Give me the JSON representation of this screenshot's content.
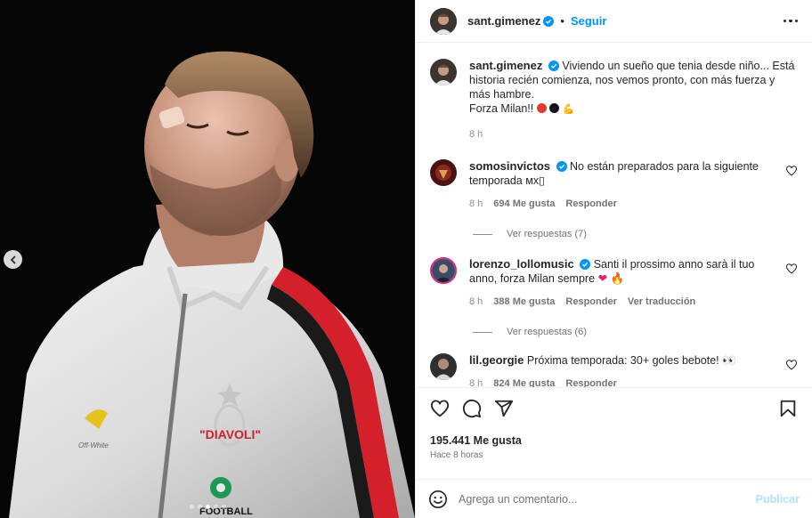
{
  "post": {
    "username": "sant.gimenez",
    "follow_label": "Seguir",
    "separator": "•",
    "caption_user": "sant.gimenez",
    "caption_text": "Viviendo un sueño que tenia desde niño... Está historia recién comienza, nos vemos pronto, con más fuerza y más hambre.",
    "caption_line2": "Forza Milan!!",
    "caption_time": "8 h",
    "likes": "195.441 Me gusta",
    "posted_ago": "Hace 8 horas"
  },
  "image": {
    "jacket_text": "\"DIAVOLI\"",
    "logo_text": "FOOTBALL",
    "carousel_dots": 5,
    "active_dot": 2
  },
  "comments": [
    {
      "user": "somosinvictos",
      "verified": true,
      "text": "No están preparados para la siguiente temporada ᴍx▯",
      "time": "8 h",
      "likes": "694 Me gusta",
      "reply": "Responder",
      "replies": "Ver respuestas (7)",
      "avatar_color": "#5a1a1a"
    },
    {
      "user": "lorenzo_lollomusic",
      "verified": true,
      "text": "Santi il prossimo anno sarà il tuo anno, forza Milan sempre",
      "time": "8 h",
      "likes": "388 Me gusta",
      "reply": "Responder",
      "translate": "Ver traducción",
      "replies": "Ver respuestas (6)",
      "avatar_color": "#3b4a66"
    },
    {
      "user": "lil.georgie",
      "verified": false,
      "text": "Próxima temporada: 30+ goles bebote! 👀",
      "time": "8 h",
      "likes": "824 Me gusta",
      "reply": "Responder",
      "avatar_color": "#444444"
    }
  ],
  "composer": {
    "placeholder": "Agrega un comentario...",
    "publish": "Publicar"
  },
  "icons": {
    "verified_color": "#0095f6",
    "link_color": "#0095f6",
    "heart": "heart-icon",
    "comment": "comment-icon",
    "share": "share-icon",
    "save": "bookmark-icon",
    "emoji": "emoji-icon",
    "prev": "chevron-left-icon"
  }
}
